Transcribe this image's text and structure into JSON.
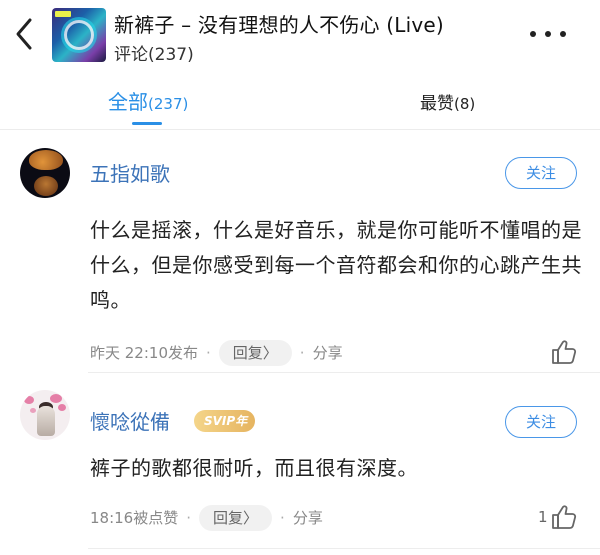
{
  "header": {
    "title": "新裤子 – 没有理想的人不伤心 (Live)",
    "subtitle": "评论(237)"
  },
  "tabs": [
    {
      "label": "全部",
      "count": "(237)"
    },
    {
      "label": "最赞",
      "count": "(8)"
    }
  ],
  "comments": [
    {
      "username": "五指如歌",
      "follow_label": "关注",
      "content": "什么是摇滚，什么是好音乐，就是你可能听不懂唱的是什么，但是你感受到每一个音符都会和你的心跳产生共鸣。",
      "time": "昨天 22:10发布",
      "reply_label": "回复〉",
      "share_label": "分享",
      "likes": ""
    },
    {
      "username": "懷唸從備",
      "badge": "SVIP年",
      "follow_label": "关注",
      "content": "裤子的歌都很耐听，而且很有深度。",
      "time": "18:16被点赞",
      "reply_label": "回复〉",
      "share_label": "分享",
      "likes": "1"
    }
  ],
  "colors": {
    "accent": "#2a8fe6",
    "username": "#3c73b8",
    "svip": "#e6b460"
  }
}
